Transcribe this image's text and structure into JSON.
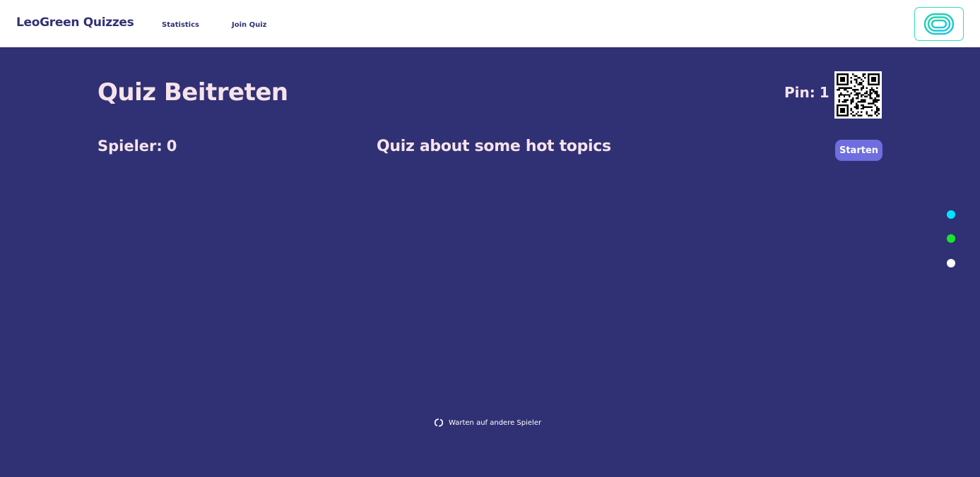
{
  "nav": {
    "brand": "LeoGreen Quizzes",
    "links": [
      "Statistics",
      "Join Quiz"
    ],
    "logo_icon": "leogreen-logo-icon"
  },
  "main": {
    "title": "Quiz Beitreten",
    "pin_label": "Pin:",
    "pin_value": "1",
    "players_label": "Spieler:",
    "players_count": "0",
    "quiz_name": "Quiz about some hot topics",
    "start_button": "Starten",
    "waiting_text": "Warten auf andere Spieler",
    "spinner_icon": "loading-spinner-icon",
    "qr_icon": "qr-code-icon"
  },
  "side_dots": [
    {
      "name": "cyan",
      "color": "#00e5ff"
    },
    {
      "name": "green",
      "color": "#19e62b"
    },
    {
      "name": "white",
      "color": "#ffffff"
    }
  ],
  "colors": {
    "background": "#303174",
    "navbar": "#ffffff",
    "text_light": "#f6e3ea",
    "button": "#6e6ede",
    "accent": "#2fe0b8"
  }
}
